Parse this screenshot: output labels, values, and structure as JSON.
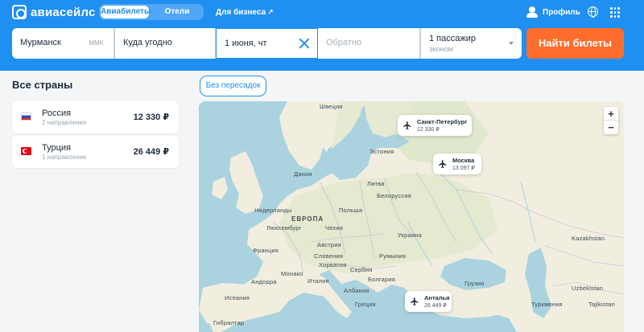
{
  "header": {
    "logo_text": "авиасейлс",
    "tabs": [
      {
        "label": "Авиабилеты",
        "active": true
      },
      {
        "label": "Отели",
        "active": false
      }
    ],
    "business_link": "Для бизнеса",
    "profile_label": "Профиль"
  },
  "search": {
    "origin": "Мурманск",
    "origin_code": "MMK",
    "destination": "Куда угодно",
    "depart_date": "1 июня, чт",
    "return_placeholder": "Обратно",
    "passengers": "1 пассажир",
    "cabin_class": "эконом",
    "submit_label": "Найти билеты"
  },
  "left_panel": {
    "title": "Все страны",
    "countries": [
      {
        "name": "Россия",
        "sub": "2 направления",
        "price": "12 330 ₽",
        "flag": "ru"
      },
      {
        "name": "Турция",
        "sub": "1 направление",
        "price": "26 449 ₽",
        "flag": "tr"
      }
    ]
  },
  "filters": {
    "nonstop_label": "Без пересадок"
  },
  "map": {
    "zoom_in": "+",
    "zoom_out": "−",
    "pins": [
      {
        "city": "Санкт-Петербург",
        "price": "12 330 ₽"
      },
      {
        "city": "Москва",
        "price": "13 097 ₽"
      },
      {
        "city": "Анталья",
        "price": "26 449 ₽"
      }
    ],
    "labels": {
      "sweden": "Швеция",
      "estonia": "Эстония",
      "denmark": "Дания",
      "lithuania": "Литва",
      "belarus": "Белоруссия",
      "netherlands": "Нидерланды",
      "europe": "ЕВРОПА",
      "poland": "Польша",
      "luxembourg": "Люксембург",
      "czech": "Чехия",
      "ukraine": "Украина",
      "kazakhstan": "Kazakhstan",
      "austria": "Австрия",
      "france": "Франция",
      "slovenia": "Словения",
      "romania": "Румыния",
      "croatia": "Хорватия",
      "monaco": "Монако",
      "serbia": "Сербия",
      "andorra": "Андорра",
      "italy": "Италия",
      "bulgaria": "Болгария",
      "georgia": "Грузия",
      "uzbekistan": "Uzbekistan",
      "spain": "Испания",
      "albania": "Албания",
      "tajikistan": "Tajikistan",
      "greece": "Греция",
      "turkmenistan": "Туркмения",
      "gibraltar": "Гибралтар"
    }
  },
  "colors": {
    "brand_blue": "#1f8ff2",
    "cta_orange": "#ff6d2c"
  }
}
